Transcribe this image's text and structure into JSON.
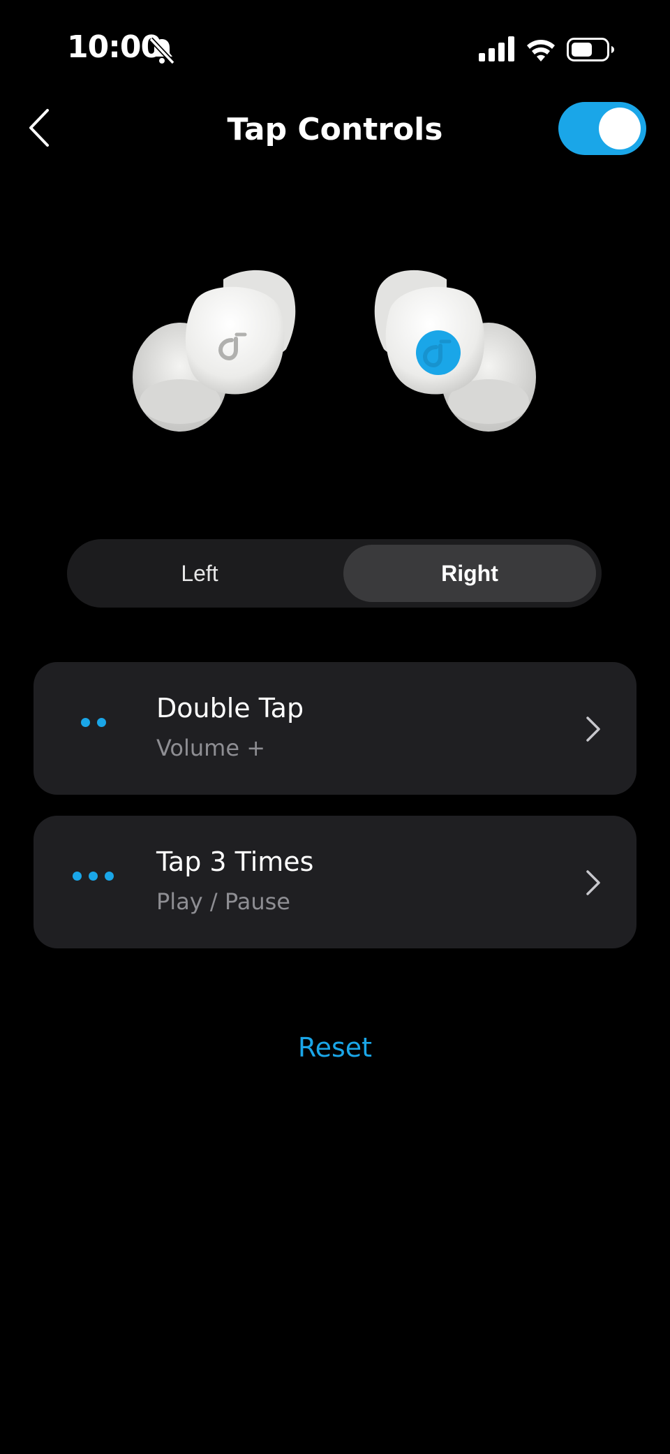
{
  "status_bar": {
    "time": "10:00"
  },
  "header": {
    "title": "Tap Controls",
    "toggle_on": true
  },
  "colors": {
    "accent": "#1aa6e8",
    "card_bg": "#1f1f22",
    "secondary_text": "#8e8e93"
  },
  "earbuds": {
    "selected_side": "Right"
  },
  "segment": {
    "left_label": "Left",
    "right_label": "Right",
    "selected": "Right"
  },
  "controls": [
    {
      "label": "Double Tap",
      "value": "Volume +",
      "icon": "two-dots-icon"
    },
    {
      "label": "Tap 3 Times",
      "value": "Play / Pause",
      "icon": "three-dots-icon"
    }
  ],
  "reset_label": "Reset"
}
